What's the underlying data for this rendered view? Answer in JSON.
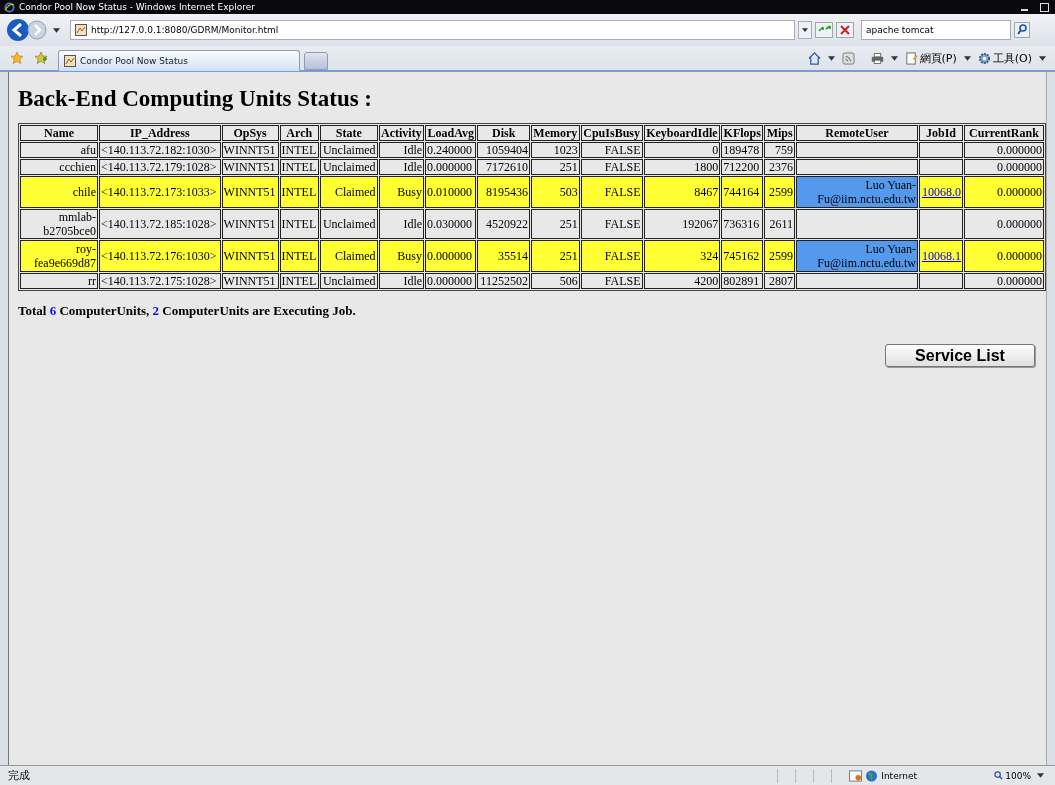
{
  "window": {
    "title": "Condor Pool Now Status - Windows Internet Explorer"
  },
  "address_bar": {
    "url": "http://127.0.0.1:8080/GDRM/Monitor.html"
  },
  "search": {
    "value": "apache tomcat"
  },
  "tabs": [
    {
      "label": "Condor Pool Now Status",
      "selected": true
    }
  ],
  "toolbar": {
    "page_menu": "網頁(P)",
    "tools_menu": "工具(O)"
  },
  "page": {
    "heading": "Back-End Computing Units Status :",
    "table": {
      "columns": [
        "Name",
        "IP_Address",
        "OpSys",
        "Arch",
        "State",
        "Activity",
        "LoadAvg",
        "Disk",
        "Memory",
        "CpuIsBusy",
        "KeyboardIdle",
        "KFlops",
        "Mips",
        "RemoteUser",
        "JobId",
        "CurrentRank"
      ],
      "rows": [
        {
          "highlighted": false,
          "name": "afu",
          "ip_address": "<140.113.72.182:1030>",
          "opsys": "WINNT51",
          "arch": "INTEL",
          "state": "Unclaimed",
          "activity": "Idle",
          "load_avg": "0.240000",
          "disk": "1059404",
          "memory": "1023",
          "cpu_is_busy": "FALSE",
          "keyboard_idle": "0",
          "kflops": "189478",
          "mips": "759",
          "current_rank": "0.000000"
        },
        {
          "highlighted": false,
          "name": "ccchien",
          "ip_address": "<140.113.72.179:1028>",
          "opsys": "WINNT51",
          "arch": "INTEL",
          "state": "Unclaimed",
          "activity": "Idle",
          "load_avg": "0.000000",
          "disk": "7172610",
          "memory": "251",
          "cpu_is_busy": "FALSE",
          "keyboard_idle": "1800",
          "kflops": "712200",
          "mips": "2376",
          "current_rank": "0.000000"
        },
        {
          "highlighted": true,
          "name": "chile",
          "ip_address": "<140.113.72.173:1033>",
          "opsys": "WINNT51",
          "arch": "INTEL",
          "state": "Claimed",
          "activity": "Busy",
          "load_avg": "0.010000",
          "disk": "8195436",
          "memory": "503",
          "cpu_is_busy": "FALSE",
          "keyboard_idle": "8467",
          "kflops": "744164",
          "mips": "2599",
          "remote_user": "Luo Yuan-Fu@iim.nctu.edu.tw",
          "job_id": "10068.0",
          "current_rank": "0.000000"
        },
        {
          "highlighted": false,
          "name": "mmlab-b2705bce0",
          "ip_address": "<140.113.72.185:1028>",
          "opsys": "WINNT51",
          "arch": "INTEL",
          "state": "Unclaimed",
          "activity": "Idle",
          "load_avg": "0.030000",
          "disk": "4520922",
          "memory": "251",
          "cpu_is_busy": "FALSE",
          "keyboard_idle": "192067",
          "kflops": "736316",
          "mips": "2611",
          "current_rank": "0.000000"
        },
        {
          "highlighted": true,
          "name": "roy-fea9e669d87",
          "ip_address": "<140.113.72.176:1030>",
          "opsys": "WINNT51",
          "arch": "INTEL",
          "state": "Claimed",
          "activity": "Busy",
          "load_avg": "0.000000",
          "disk": "35514",
          "memory": "251",
          "cpu_is_busy": "FALSE",
          "keyboard_idle": "324",
          "kflops": "745162",
          "mips": "2599",
          "remote_user": "Luo Yuan-Fu@iim.nctu.edu.tw",
          "job_id": "10068.1",
          "current_rank": "0.000000"
        },
        {
          "highlighted": false,
          "name": "rr",
          "ip_address": "<140.113.72.175:1028>",
          "opsys": "WINNT51",
          "arch": "INTEL",
          "state": "Unclaimed",
          "activity": "Idle",
          "load_avg": "0.000000",
          "disk": "11252502",
          "memory": "506",
          "cpu_is_busy": "FALSE",
          "keyboard_idle": "4200",
          "kflops": "802891",
          "mips": "2807",
          "current_rank": "0.000000"
        }
      ]
    },
    "summary": {
      "prefix": "Total",
      "total": "6",
      "middle": "ComputerUnits,",
      "executing": "2",
      "suffix": "ComputerUnits are Executing Job."
    },
    "service_button": "Service List"
  },
  "status_bar": {
    "text": "完成",
    "zone": "Internet",
    "zoom": "100%"
  }
}
